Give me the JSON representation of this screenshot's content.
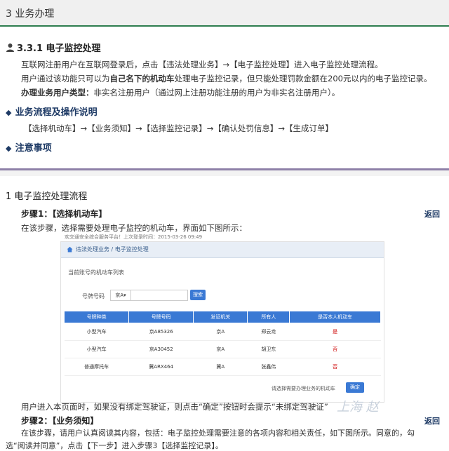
{
  "section": {
    "title": "3  业务办理"
  },
  "sub": {
    "icon": "user-icon",
    "title": "3.3.1 电子监控处理",
    "line1": "互联网注册用户在互联网登录后，点击【违法处理业务】→【电子监控处理】进入电子监控处理流程。",
    "line2_a": "用户通过该功能只可以为",
    "line2_b": "自己名下的机动车",
    "line2_c": "处理电子监控记录，但只能处理罚款金额在200元以内的电子监控记录。",
    "line3_a": "办理业务用户类型：",
    "line3_b": "非实名注册用户（通过网上注册功能注册的用户为非实名注册用户）。"
  },
  "flow": {
    "heading": "业务流程及操作说明",
    "steps": "【选择机动车】→【业务须知】→【选择监控记录】→【确认处罚信息】→【生成订单】"
  },
  "notice": {
    "heading": "注意事项"
  },
  "process": {
    "title": "1 电子监控处理流程",
    "step1_title": "步骤1：【选择机动车】",
    "step1_desc": "在该步骤，选择需要处理电子监控的机动车，界面如下图所示：",
    "return1": "返回",
    "after_shot": "用户进入本页面时，如果没有绑定驾驶证，则点击“确定”按钮时会提示“未绑定驾驶证”",
    "step2_title": "步骤2：【业务须知】",
    "return2": "返回",
    "step2_desc1": "在该步骤，请用户认真阅读其内容，包括：电子监控处理需要注意的各项内容和相关责任，如下图所示。同意的，勾",
    "step2_desc2": "选“阅读并同意”，点击【下一步】进入步骤3【选择监控记录】。"
  },
  "shot": {
    "topline": "欢交通安全综合服务平台！上次登录时间：2015-03-26 09:49",
    "nav": "违法处理业务 / 电子监控处理",
    "list_label": "当前账号的机动车列表",
    "plate_label": "号牌号码",
    "plate_select": "京A▾",
    "search_button": "搜索",
    "headers": [
      "号牌种类",
      "号牌号码",
      "发证机关",
      "所有人",
      "是否本人机动车"
    ],
    "rows": [
      [
        "小型汽车",
        "京A85326",
        "京A",
        "郑云龙",
        "是"
      ],
      [
        "小型汽车",
        "京A30452",
        "京A",
        "胡卫东",
        "否"
      ],
      [
        "普通摩托车",
        "冀ARX464",
        "冀A",
        "张鑫伟",
        "否"
      ]
    ],
    "footer_hint": "请选择需要办理业务的机动车",
    "confirm_button": "确定"
  },
  "watermark": "上海 赵"
}
